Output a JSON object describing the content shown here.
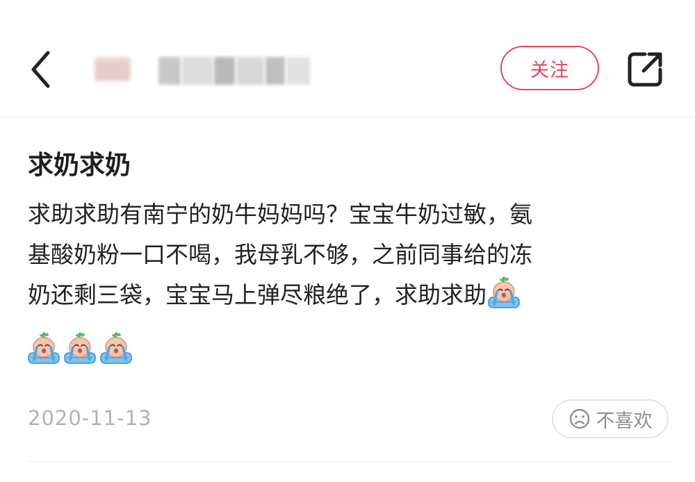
{
  "header": {
    "follow_label": "关注",
    "icons": {
      "back": "chevron-left-icon",
      "share": "share-external-icon"
    },
    "accent_color": "#e8435b"
  },
  "post": {
    "title": "求奶求奶",
    "body_lines": [
      "求助求助有南宁的奶牛妈妈吗？宝宝牛奶过敏，氨",
      "基酸奶粉一口不喝，我母乳不够，之前同事给的冻",
      "奶还剩三袋，宝宝马上弹尽粮绝了，求助求助"
    ],
    "emoji_name": "crying-baby-emoji",
    "emoji_count": 4,
    "date": "2020-11-13",
    "dislike_label": "不喜欢"
  }
}
